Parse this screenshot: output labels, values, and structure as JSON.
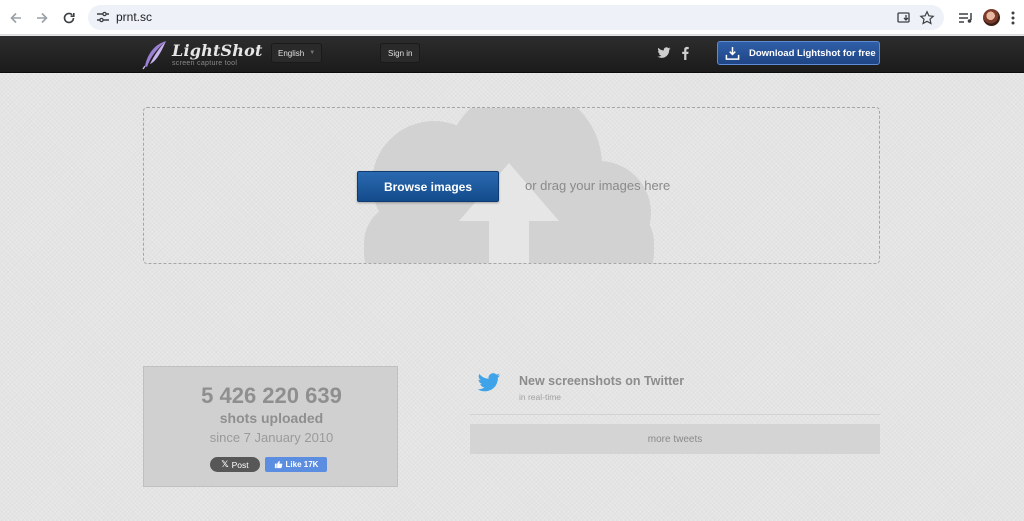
{
  "browser": {
    "url": "prnt.sc",
    "icons": {
      "back": "back-arrow-icon",
      "forward": "forward-arrow-icon",
      "reload": "reload-icon",
      "site_settings": "tune-icon",
      "install": "install-app-icon",
      "bookmark": "star-icon",
      "media": "media-controls-icon",
      "profile": "avatar",
      "menu": "kebab-menu-icon"
    }
  },
  "header": {
    "logo_title": "LightShot",
    "logo_subtitle": "screen capture tool",
    "language": "English",
    "signin_label": "Sign in",
    "download_label": "Download Lightshot for free",
    "social_icons": [
      "twitter-icon",
      "facebook-icon"
    ]
  },
  "upload": {
    "browse_label": "Browse images",
    "drag_text": "or drag your images here"
  },
  "stats": {
    "count": "5 426 220 639",
    "uploaded_label": "shots uploaded",
    "since_label": "since 7 January 2010",
    "x_post_label": "Post",
    "x_post_glyph": "𝕏",
    "fb_like_label": "Like 17K"
  },
  "twitter": {
    "title": "New screenshots on Twitter",
    "subtitle": "in real-time",
    "more_label": "more tweets"
  },
  "colors": {
    "header_bg": "#1f1f1f",
    "accent_blue": "#1f4f96",
    "page_bg": "#e4e4e4",
    "twitter_blue": "#3ea3e8",
    "facebook_blue": "#5b8de0"
  }
}
